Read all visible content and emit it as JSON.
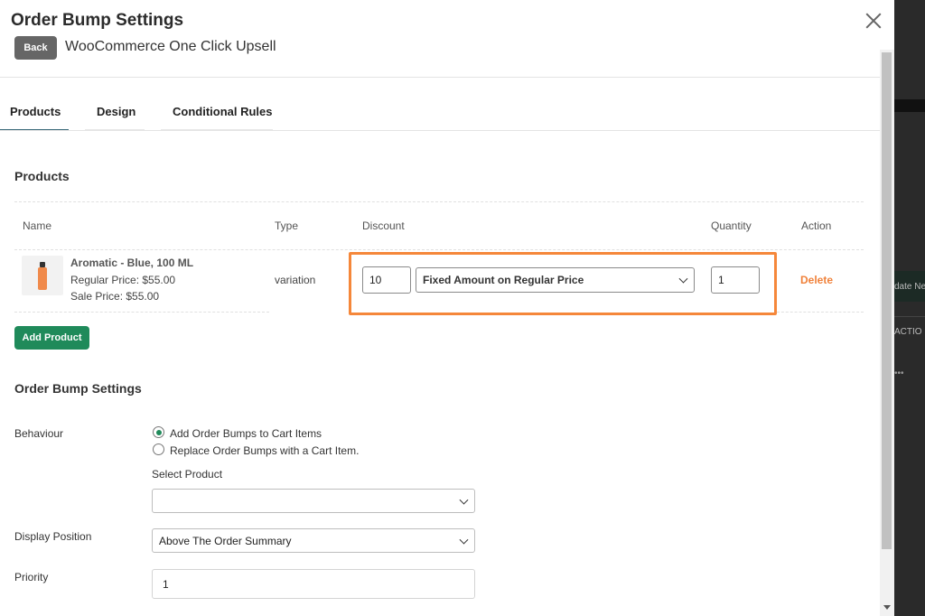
{
  "background": {
    "text_update": "date Ne",
    "text_action": "ACTIO",
    "text_more": "•••"
  },
  "modal": {
    "title": "Order Bump Settings",
    "back_label": "Back",
    "plugin_name": "WooCommerce One Click Upsell"
  },
  "tabs": [
    {
      "label": "Products",
      "active": true
    },
    {
      "label": "Design",
      "active": false
    },
    {
      "label": "Conditional Rules",
      "active": false
    }
  ],
  "products_section": {
    "title": "Products",
    "columns": {
      "name": "Name",
      "type": "Type",
      "discount": "Discount",
      "quantity": "Quantity",
      "action": "Action"
    },
    "rows": [
      {
        "name": "Aromatic - Blue, 100 ML",
        "regular_price": "Regular Price: $55.00",
        "sale_price": "Sale Price: $55.00",
        "type": "variation",
        "discount_value": "10",
        "discount_type": "Fixed Amount on Regular Price",
        "quantity": "1",
        "action": "Delete"
      }
    ],
    "add_button": "Add Product"
  },
  "settings_section": {
    "title": "Order Bump Settings",
    "behaviour_label": "Behaviour",
    "behaviour_options": [
      {
        "label": "Add Order Bumps to Cart Items",
        "checked": true
      },
      {
        "label": "Replace Order Bumps with a Cart Item.",
        "checked": false
      }
    ],
    "select_product_label": "Select Product",
    "select_product_value": "",
    "display_position_label": "Display Position",
    "display_position_value": "Above The Order Summary",
    "priority_label": "Priority",
    "priority_value": "1"
  },
  "colors": {
    "accent_green": "#1f8a5a",
    "highlight_orange": "#f5873a",
    "delete_orange": "#f0813a"
  }
}
